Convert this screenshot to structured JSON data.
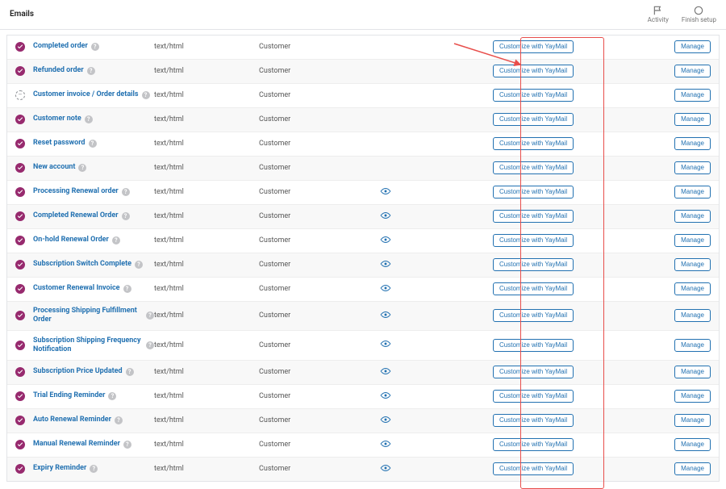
{
  "header": {
    "title": "Emails",
    "activity": "Activity",
    "finish": "Finish setup"
  },
  "buttons": {
    "customize": "Customize with YayMail",
    "manage": "Manage"
  },
  "rows": [
    {
      "name": "Completed order",
      "type": "text/html",
      "recipient": "Customer",
      "status": "check",
      "eye": false
    },
    {
      "name": "Refunded order",
      "type": "text/html",
      "recipient": "Customer",
      "status": "check",
      "eye": false
    },
    {
      "name": "Customer invoice / Order details",
      "type": "text/html",
      "recipient": "Customer",
      "status": "dash",
      "eye": false
    },
    {
      "name": "Customer note",
      "type": "text/html",
      "recipient": "Customer",
      "status": "check",
      "eye": false
    },
    {
      "name": "Reset password",
      "type": "text/html",
      "recipient": "Customer",
      "status": "check",
      "eye": false
    },
    {
      "name": "New account",
      "type": "text/html",
      "recipient": "Customer",
      "status": "check",
      "eye": false
    },
    {
      "name": "Processing Renewal order",
      "type": "text/html",
      "recipient": "Customer",
      "status": "check",
      "eye": true
    },
    {
      "name": "Completed Renewal Order",
      "type": "text/html",
      "recipient": "Customer",
      "status": "check",
      "eye": true
    },
    {
      "name": "On-hold Renewal Order",
      "type": "text/html",
      "recipient": "Customer",
      "status": "check",
      "eye": true
    },
    {
      "name": "Subscription Switch Complete",
      "type": "text/html",
      "recipient": "Customer",
      "status": "check",
      "eye": true
    },
    {
      "name": "Customer Renewal Invoice",
      "type": "text/html",
      "recipient": "Customer",
      "status": "check",
      "eye": true
    },
    {
      "name": "Processing Shipping Fulfillment Order",
      "type": "text/html",
      "recipient": "Customer",
      "status": "check",
      "eye": true
    },
    {
      "name": "Subscription Shipping Frequency Notification",
      "type": "text/html",
      "recipient": "Customer",
      "status": "check",
      "eye": true
    },
    {
      "name": "Subscription Price Updated",
      "type": "text/html",
      "recipient": "Customer",
      "status": "check",
      "eye": true
    },
    {
      "name": "Trial Ending Reminder",
      "type": "text/html",
      "recipient": "Customer",
      "status": "check",
      "eye": true
    },
    {
      "name": "Auto Renewal Reminder",
      "type": "text/html",
      "recipient": "Customer",
      "status": "check",
      "eye": true
    },
    {
      "name": "Manual Renewal Reminder",
      "type": "text/html",
      "recipient": "Customer",
      "status": "check",
      "eye": true
    },
    {
      "name": "Expiry Reminder",
      "type": "text/html",
      "recipient": "Customer",
      "status": "check",
      "eye": true
    }
  ]
}
